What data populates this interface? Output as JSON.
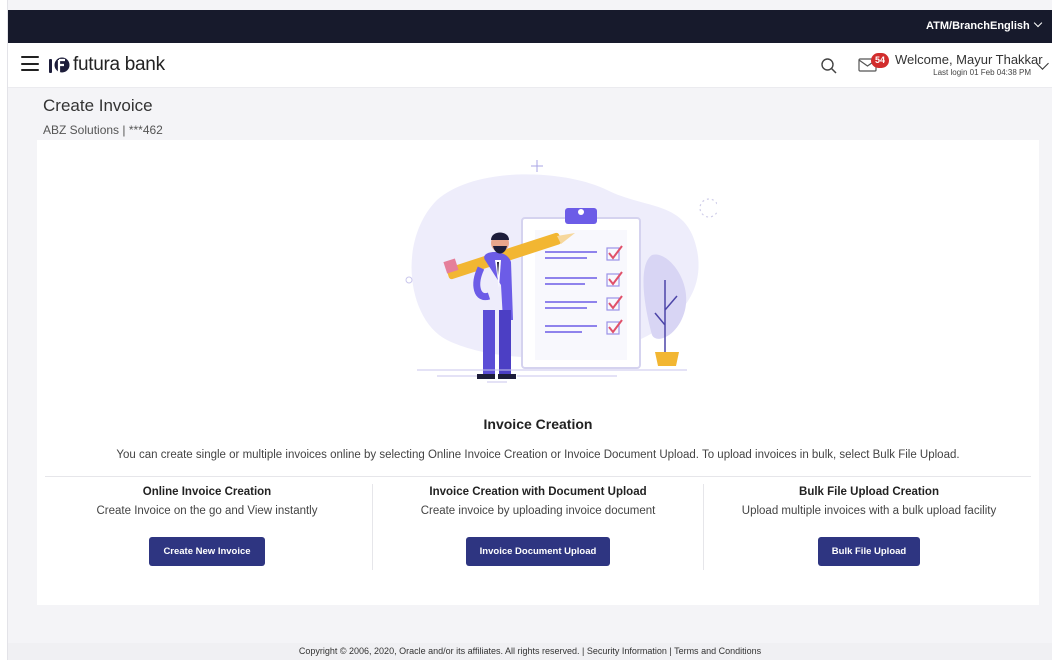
{
  "topbar": {
    "atm_branch": "ATM/Branch",
    "language": "English"
  },
  "header": {
    "brand": "futura bank",
    "notifications_count": "54",
    "welcome": "Welcome, Mayur Thakkar",
    "last_login": "Last login 01 Feb 04:38 PM"
  },
  "page": {
    "title": "Create Invoice",
    "account": "ABZ Solutions | ***462"
  },
  "main": {
    "section_title": "Invoice Creation",
    "description": "You can create single or multiple invoices online by selecting Online Invoice Creation or Invoice Document Upload. To upload invoices in bulk, select Bulk File Upload.",
    "options": [
      {
        "title": "Online Invoice Creation",
        "desc": "Create Invoice on the go and View instantly",
        "button": "Create New Invoice"
      },
      {
        "title": "Invoice Creation with Document Upload",
        "desc": "Create invoice by uploading invoice document",
        "button": "Invoice Document Upload"
      },
      {
        "title": "Bulk File Upload Creation",
        "desc": "Upload multiple invoices with a bulk upload facility",
        "button": "Bulk File Upload"
      }
    ]
  },
  "footer": {
    "copyright": "Copyright © 2006, 2020, Oracle and/or its affiliates. All rights reserved.",
    "sep": " | ",
    "security": "Security Information",
    "terms": "Terms and Conditions"
  },
  "colors": {
    "topbar": "#171a2c",
    "primary_button": "#2e3581",
    "badge": "#d22d2d",
    "illustration_purple": "#6c5ce7"
  }
}
